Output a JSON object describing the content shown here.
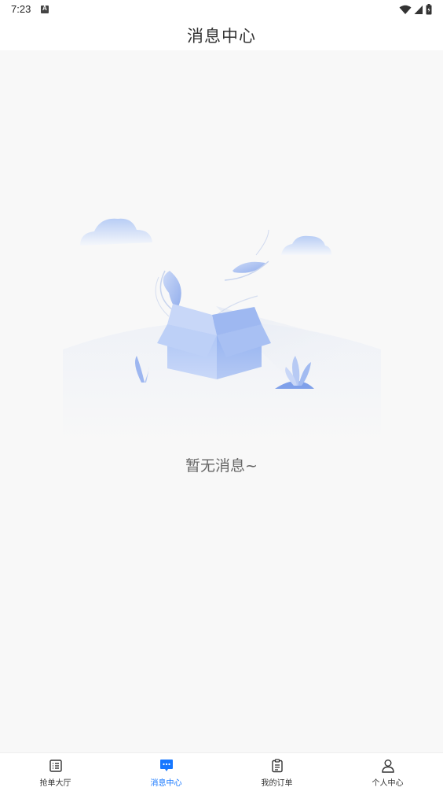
{
  "status_bar": {
    "time": "7:23",
    "notification_icon": "a-icon",
    "icons": [
      "wifi-icon",
      "signal-icon",
      "battery-icon"
    ]
  },
  "header": {
    "title": "消息中心"
  },
  "main": {
    "illustration": "empty-box-illustration",
    "empty_text": "暂无消息~"
  },
  "tabbar": {
    "active_color": "#1677ff",
    "items": [
      {
        "label": "抢单大厅",
        "icon": "list-icon",
        "active": false
      },
      {
        "label": "消息中心",
        "icon": "message-icon",
        "active": true
      },
      {
        "label": "我的订单",
        "icon": "clipboard-icon",
        "active": false
      },
      {
        "label": "个人中心",
        "icon": "person-icon",
        "active": false
      }
    ]
  }
}
